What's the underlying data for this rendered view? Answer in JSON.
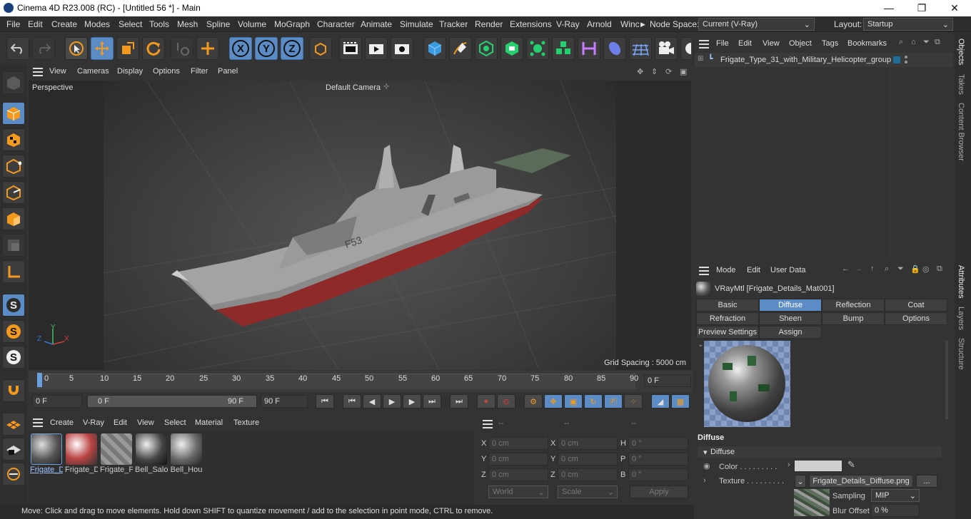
{
  "window": {
    "title": "Cinema 4D R23.008 (RC) - [Untitled 56 *] - Main",
    "min": "—",
    "max": "❐",
    "close": "✕"
  },
  "menu": {
    "items": [
      "File",
      "Edit",
      "Create",
      "Modes",
      "Select",
      "Tools",
      "Mesh",
      "Spline",
      "Volume",
      "MoGraph",
      "Character",
      "Animate",
      "Simulate",
      "Tracker",
      "Render",
      "Extensions",
      "V-Ray",
      "Arnold",
      "Winc"
    ],
    "node_space_label": "Node Space:",
    "node_space_value": "Current (V-Ray)",
    "layout_label": "Layout:",
    "layout_value": "Startup"
  },
  "toolbar": {
    "x": "X",
    "y": "Y",
    "z": "Z"
  },
  "viewport": {
    "menu": [
      "View",
      "Cameras",
      "Display",
      "Options",
      "Filter",
      "Panel"
    ],
    "projection": "Perspective",
    "camera": "Default Camera",
    "grid_spacing": "Grid Spacing : 5000 cm",
    "hull_number": "F53",
    "axis_y": "Y",
    "axis_z": "Z",
    "axis_x": "X"
  },
  "timeline": {
    "ticks": [
      "0",
      "5",
      "10",
      "15",
      "20",
      "25",
      "30",
      "35",
      "40",
      "45",
      "50",
      "55",
      "60",
      "65",
      "70",
      "75",
      "80",
      "85",
      "90"
    ],
    "current_frame": "0 F"
  },
  "transport": {
    "start": "0 F",
    "range_start": "0 F",
    "range_end": "90 F",
    "end": "90 F"
  },
  "materials": {
    "menu": [
      "Create",
      "V-Ray",
      "Edit",
      "View",
      "Select",
      "Material",
      "Texture"
    ],
    "items": [
      {
        "label": "Frigate_Det"
      },
      {
        "label": "Frigate_Det"
      },
      {
        "label": "Frigate_Pro"
      },
      {
        "label": "Bell_Salo"
      },
      {
        "label": "Bell_Hou"
      }
    ]
  },
  "coords": {
    "header": [
      "--",
      "--",
      "--"
    ],
    "rows": [
      {
        "a": "X",
        "av": "0 cm",
        "b": "X",
        "bv": "0 cm",
        "c": "H",
        "cv": "0 °"
      },
      {
        "a": "Y",
        "av": "0 cm",
        "b": "Y",
        "bv": "0 cm",
        "c": "P",
        "cv": "0 °"
      },
      {
        "a": "Z",
        "av": "0 cm",
        "b": "Z",
        "bv": "0 cm",
        "c": "B",
        "cv": "0 °"
      }
    ],
    "world": "World",
    "scale": "Scale",
    "apply": "Apply"
  },
  "objects": {
    "menu": [
      "File",
      "Edit",
      "View",
      "Object",
      "Tags",
      "Bookmarks"
    ],
    "item": "Frigate_Type_31_with_Military_Helicopter_group"
  },
  "attributes": {
    "menu": [
      "Mode",
      "Edit",
      "User Data"
    ],
    "material_name": "VRayMtl [Frigate_Details_Mat001]",
    "tabs_row1": [
      "Basic",
      "Diffuse",
      "Reflection",
      "Coat"
    ],
    "tabs_row2": [
      "Refraction",
      "Sheen",
      "Bump",
      "Options"
    ],
    "tabs_row3": [
      "Preview Settings",
      "Assign"
    ],
    "section": "Diffuse",
    "subsection": "Diffuse",
    "color_label": "Color . . . . . . . . .",
    "texture_label": "Texture . . . . . . . . .",
    "texture_file": "Frigate_Details_Diffuse.png",
    "more": "...",
    "sampling_label": "Sampling",
    "sampling_value": "MIP",
    "blur_label": "Blur Offset",
    "blur_value": "0 %"
  },
  "side_tabs": [
    "Objects",
    "Takes",
    "Content Browser",
    "Attributes",
    "Layers",
    "Structure"
  ],
  "status": "Move: Click and drag to move elements. Hold down SHIFT to quantize movement / add to the selection in point mode, CTRL to remove."
}
